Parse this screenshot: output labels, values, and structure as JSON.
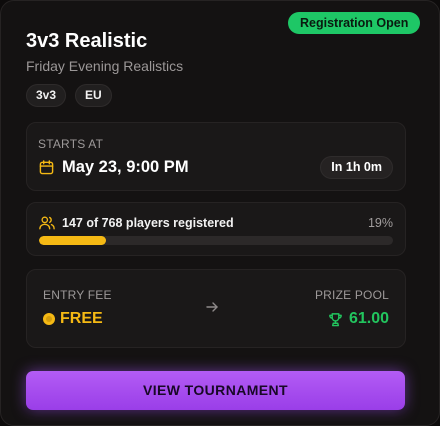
{
  "card": {
    "status_badge": "Registration Open",
    "title": "3v3 Realistic",
    "subtitle": "Friday Evening Realistics",
    "tags": [
      "3v3",
      "EU"
    ]
  },
  "start": {
    "label": "STARTS AT",
    "date": "May 23, 9:00 PM",
    "countdown": "In 1h 0m",
    "icon": "calendar-icon"
  },
  "registration": {
    "text": "147 of 768 players registered",
    "percent_label": "19%",
    "progress_fraction": 0.19,
    "icon": "users-icon"
  },
  "prize": {
    "entry_fee_label": "ENTRY FEE",
    "entry_fee_value": "FREE",
    "prize_pool_label": "PRIZE POOL",
    "prize_pool_value": "61.00",
    "icons": [
      "coin-icon",
      "arrow-right-icon",
      "trophy-icon"
    ]
  },
  "cta": {
    "label": "VIEW TOURNAMENT"
  },
  "colors": {
    "accent_green": "#22c55e",
    "accent_yellow": "#f5b914",
    "accent_purple": "#a855f7",
    "background": "#141212"
  }
}
